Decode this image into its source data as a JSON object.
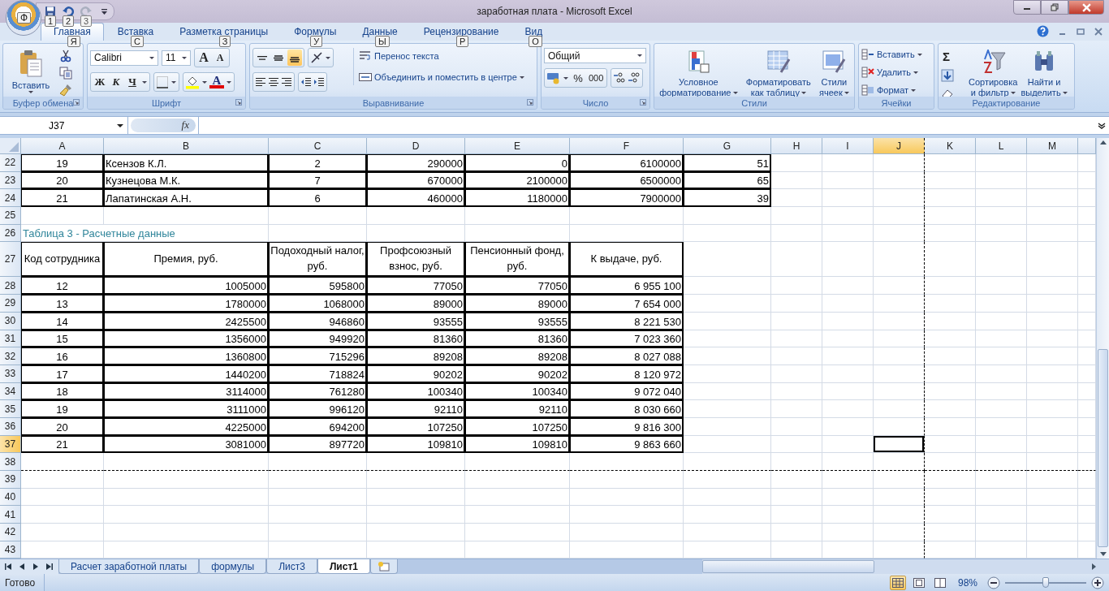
{
  "window": {
    "title": "заработная плата - Microsoft Excel"
  },
  "office_button": {
    "key_tip": "Ф"
  },
  "quick_access": [
    {
      "kind": "save",
      "key_tip": "1",
      "disabled": false
    },
    {
      "kind": "undo",
      "key_tip": "2",
      "disabled": false
    },
    {
      "kind": "redo",
      "key_tip": "3",
      "disabled": true
    }
  ],
  "tabs": [
    {
      "label": "Главная",
      "key_tip": "Я",
      "selected": true
    },
    {
      "label": "Вставка",
      "key_tip": "С",
      "selected": false
    },
    {
      "label": "Разметка страницы",
      "key_tip": "З",
      "selected": false
    },
    {
      "label": "Формулы",
      "key_tip": "У",
      "selected": false
    },
    {
      "label": "Данные",
      "key_tip": "Ы",
      "selected": false
    },
    {
      "label": "Рецензирование",
      "key_tip": "Р",
      "selected": false
    },
    {
      "label": "Вид",
      "key_tip": "О",
      "selected": false
    }
  ],
  "ribbon": {
    "clipboard": {
      "label": "Буфер обмена",
      "paste": "Вставить"
    },
    "font": {
      "label": "Шрифт",
      "font_name": "Calibri",
      "font_size": "11",
      "grow": "A",
      "shrink": "A",
      "bold": "Ж",
      "italic": "К",
      "underline": "Ч",
      "font_color": "A"
    },
    "alignment": {
      "label": "Выравнивание",
      "vertical": [
        {
          "kind": "top",
          "selected": false
        },
        {
          "kind": "middle",
          "selected": false
        },
        {
          "kind": "bottom",
          "selected": true
        }
      ],
      "wrap_text": "Перенос текста",
      "merge": "Объединить и поместить в центре"
    },
    "number": {
      "label": "Число",
      "format": "Общий",
      "percent": "%",
      "thousands": "000"
    },
    "styles": {
      "label": "Стили",
      "buttons": [
        {
          "kind": "conditional",
          "lines": [
            "Условное",
            "форматирование"
          ]
        },
        {
          "kind": "table",
          "lines": [
            "Форматировать",
            "как таблицу"
          ]
        },
        {
          "kind": "cell",
          "lines": [
            "Стили",
            "ячеек"
          ]
        }
      ]
    },
    "cells": {
      "label": "Ячейки",
      "buttons": [
        {
          "kind": "insert",
          "label": "Вставить"
        },
        {
          "kind": "delete",
          "label": "Удалить"
        },
        {
          "kind": "format",
          "label": "Формат"
        }
      ]
    },
    "editing": {
      "label": "Редактирование",
      "autosum": "Σ",
      "buttons": [
        {
          "kind": "sort",
          "lines": [
            "Сортировка",
            "и фильтр"
          ]
        },
        {
          "kind": "find",
          "lines": [
            "Найти и",
            "выделить"
          ]
        }
      ]
    }
  },
  "formula_bar": {
    "name_box": "J37",
    "fx": "fx"
  },
  "columns": [
    {
      "label": "A",
      "selected": false,
      "page_break": false
    },
    {
      "label": "B",
      "selected": false,
      "page_break": false
    },
    {
      "label": "C",
      "selected": false,
      "page_break": false
    },
    {
      "label": "D",
      "selected": false,
      "page_break": false
    },
    {
      "label": "E",
      "selected": false,
      "page_break": false
    },
    {
      "label": "F",
      "selected": false,
      "page_break": false
    },
    {
      "label": "G",
      "selected": false,
      "page_break": false
    },
    {
      "label": "H",
      "selected": false,
      "page_break": false
    },
    {
      "label": "I",
      "selected": false,
      "page_break": false
    },
    {
      "label": "J",
      "selected": true,
      "page_break": true
    },
    {
      "label": "K",
      "selected": false,
      "page_break": false
    },
    {
      "label": "L",
      "selected": false,
      "page_break": false
    },
    {
      "label": "M",
      "selected": false,
      "page_break": false
    }
  ],
  "rows": [
    {
      "number": "22",
      "kind": "data",
      "selected": false,
      "page_break": false,
      "cells": [
        "19",
        "Ксензов К.Л.",
        "2",
        "290000",
        "0",
        "6100000",
        "51"
      ]
    },
    {
      "number": "23",
      "kind": "data",
      "selected": false,
      "page_break": false,
      "cells": [
        "20",
        "Кузнецова М.К.",
        "7",
        "670000",
        "2100000",
        "6500000",
        "65"
      ]
    },
    {
      "number": "24",
      "kind": "data",
      "selected": false,
      "page_break": false,
      "cells": [
        "21",
        "Лапатинская А.Н.",
        "6",
        "460000",
        "1180000",
        "7900000",
        "39"
      ]
    },
    {
      "number": "25",
      "kind": "blank",
      "selected": false,
      "page_break": false
    },
    {
      "number": "26",
      "kind": "caption",
      "selected": false,
      "page_break": false,
      "cells": [
        "Таблица 3 - Расчетные данные"
      ]
    },
    {
      "number": "27",
      "kind": "header",
      "selected": false,
      "page_break": false,
      "cells": [
        "Код сотрудника",
        "Премия, руб.",
        "Подоходный налог, руб.",
        "Профсоюзный взнос, руб.",
        "Пенсионный фонд, руб.",
        "К выдаче, руб."
      ]
    },
    {
      "number": "28",
      "kind": "table",
      "selected": false,
      "page_break": false,
      "cells": [
        "12",
        "1005000",
        "595800",
        "77050",
        "77050",
        "6 955 100"
      ]
    },
    {
      "number": "29",
      "kind": "table",
      "selected": false,
      "page_break": false,
      "cells": [
        "13",
        "1780000",
        "1068000",
        "89000",
        "89000",
        "7 654 000"
      ]
    },
    {
      "number": "30",
      "kind": "table",
      "selected": false,
      "page_break": false,
      "cells": [
        "14",
        "2425500",
        "946860",
        "93555",
        "93555",
        "8 221 530"
      ]
    },
    {
      "number": "31",
      "kind": "table",
      "selected": false,
      "page_break": false,
      "cells": [
        "15",
        "1356000",
        "949920",
        "81360",
        "81360",
        "7 023 360"
      ]
    },
    {
      "number": "32",
      "kind": "table",
      "selected": false,
      "page_break": false,
      "cells": [
        "16",
        "1360800",
        "715296",
        "89208",
        "89208",
        "8 027 088"
      ]
    },
    {
      "number": "33",
      "kind": "table",
      "selected": false,
      "page_break": false,
      "cells": [
        "17",
        "1440200",
        "718824",
        "90202",
        "90202",
        "8 120 972"
      ]
    },
    {
      "number": "34",
      "kind": "table",
      "selected": false,
      "page_break": false,
      "cells": [
        "18",
        "3114000",
        "761280",
        "100340",
        "100340",
        "9 072 040"
      ]
    },
    {
      "number": "35",
      "kind": "table",
      "selected": false,
      "page_break": false,
      "cells": [
        "19",
        "3111000",
        "996120",
        "92110",
        "92110",
        "8 030 660"
      ]
    },
    {
      "number": "36",
      "kind": "table",
      "selected": false,
      "page_break": false,
      "cells": [
        "20",
        "4225000",
        "694200",
        "107250",
        "107250",
        "9 816 300"
      ]
    },
    {
      "number": "37",
      "kind": "table",
      "selected": true,
      "page_break": false,
      "cells": [
        "21",
        "3081000",
        "897720",
        "109810",
        "109810",
        "9 863 660"
      ]
    },
    {
      "number": "38",
      "kind": "blank",
      "selected": false,
      "page_break": true
    },
    {
      "number": "39",
      "kind": "blank",
      "selected": false,
      "page_break": false
    },
    {
      "number": "40",
      "kind": "blank",
      "selected": false,
      "page_break": false
    },
    {
      "number": "41",
      "kind": "blank",
      "selected": false,
      "page_break": false
    },
    {
      "number": "42",
      "kind": "blank",
      "selected": false,
      "page_break": false
    },
    {
      "number": "43",
      "kind": "blank",
      "selected": false,
      "page_break": false
    }
  ],
  "sheet_tabs": [
    {
      "label": "Расчет заработной платы",
      "selected": false
    },
    {
      "label": "формулы",
      "selected": false
    },
    {
      "label": "Лист3",
      "selected": false
    },
    {
      "label": "Лист1",
      "selected": true
    }
  ],
  "status_bar": {
    "text": "Готово",
    "views": [
      {
        "kind": "normal",
        "selected": true
      },
      {
        "kind": "layout",
        "selected": false
      },
      {
        "kind": "page_break",
        "selected": false
      }
    ],
    "zoom": "98%",
    "zoom_slider": {
      "level": 0.5
    }
  }
}
